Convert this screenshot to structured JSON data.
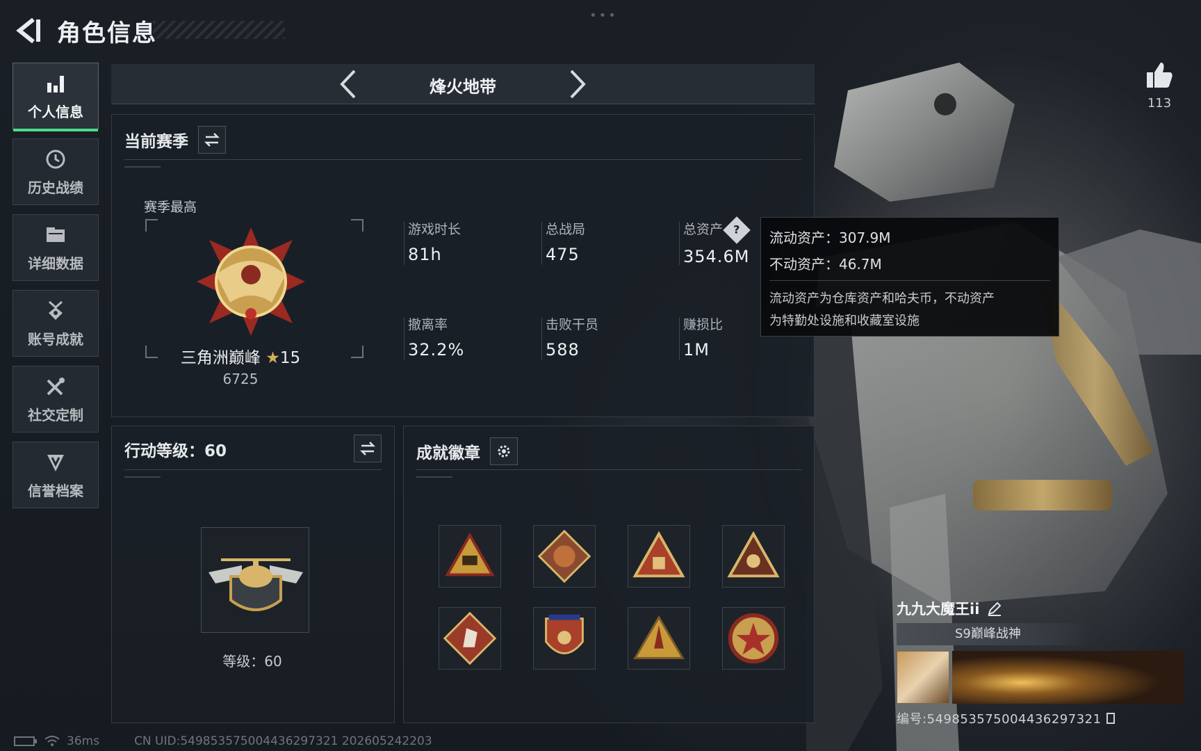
{
  "page": {
    "title": "角色信息"
  },
  "nav": {
    "items": [
      {
        "label": "个人信息",
        "icon": "bar-chart-icon",
        "active": true
      },
      {
        "label": "历史战绩",
        "icon": "history-clock-icon",
        "active": false
      },
      {
        "label": "详细数据",
        "icon": "folder-icon",
        "active": false
      },
      {
        "label": "账号成就",
        "icon": "achievement-medal-icon",
        "active": false
      },
      {
        "label": "社交定制",
        "icon": "tools-icon",
        "active": false
      },
      {
        "label": "信誉档案",
        "icon": "reputation-shield-icon",
        "active": false
      }
    ]
  },
  "mode": {
    "title": "烽火地带"
  },
  "season": {
    "title": "当前赛季",
    "best_label": "赛季最高",
    "rank_name": "三角洲巅峰",
    "rank_stars": "15",
    "rank_score": "6725",
    "stats": [
      {
        "label": "游戏时长",
        "value": "81h"
      },
      {
        "label": "总战局",
        "value": "475"
      },
      {
        "label": "总资产",
        "value": "354.6M",
        "help": "?"
      },
      {
        "label": "撤离率",
        "value": "32.2%"
      },
      {
        "label": "击败干员",
        "value": "588"
      },
      {
        "label": "赚损比",
        "value": "1M"
      }
    ]
  },
  "tooltip": {
    "liquid": "流动资产：307.9M",
    "fixed": "不动资产：46.7M",
    "desc_line1": "流动资产为仓库资产和哈夫币，不动资产",
    "desc_line2": "为特勤处设施和收藏室设施"
  },
  "action_level": {
    "title": "行动等级：60",
    "level_text": "等级：60"
  },
  "achievements": {
    "title": "成就徽章",
    "badges": [
      "s8-triangle-badge",
      "dragon-diamond-badge",
      "supply-triangle-badge",
      "squad-triangle-badge",
      "horse-diamond-badge",
      "shield-star-badge",
      "rocket-triangle-badge",
      "star-medal-badge"
    ]
  },
  "like": {
    "count": "113",
    "icon": "thumbs-up-icon"
  },
  "player": {
    "name": "九九大魔王ii",
    "title": "S9巅峰战神",
    "id_text": "编号:549853575004436297321"
  },
  "status": {
    "ping": "36ms",
    "uid_text": "CN UID:549853575004436297321 202605242203"
  },
  "colors": {
    "accent": "#4ddb8a",
    "gold": "#d4b05a",
    "panel": "#1a1f26"
  }
}
